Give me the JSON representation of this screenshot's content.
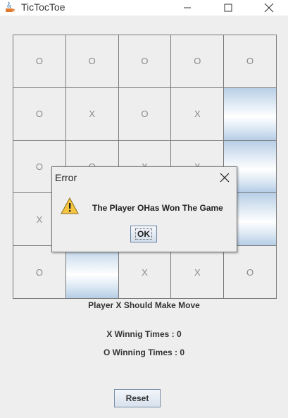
{
  "window": {
    "title": "TicTocToe"
  },
  "board": {
    "cells": [
      [
        "O",
        "O",
        "O",
        "O",
        "O"
      ],
      [
        "O",
        "X",
        "O",
        "X",
        ""
      ],
      [
        "O",
        "O",
        "X",
        "X",
        ""
      ],
      [
        "X",
        "",
        "",
        "",
        ""
      ],
      [
        "O",
        "",
        "X",
        "X",
        "O"
      ]
    ]
  },
  "status": {
    "turn": "Player X Should Make Move",
    "x_wins": "X Winnig Times : 0",
    "o_wins": "O Winning Times : 0"
  },
  "controls": {
    "reset_label": "Reset"
  },
  "dialog": {
    "title": "Error",
    "message": "The Player OHas Won The Game",
    "ok_label": "OK"
  },
  "colors": {
    "highlight": "#c9dbef",
    "background": "#eeeeee"
  }
}
